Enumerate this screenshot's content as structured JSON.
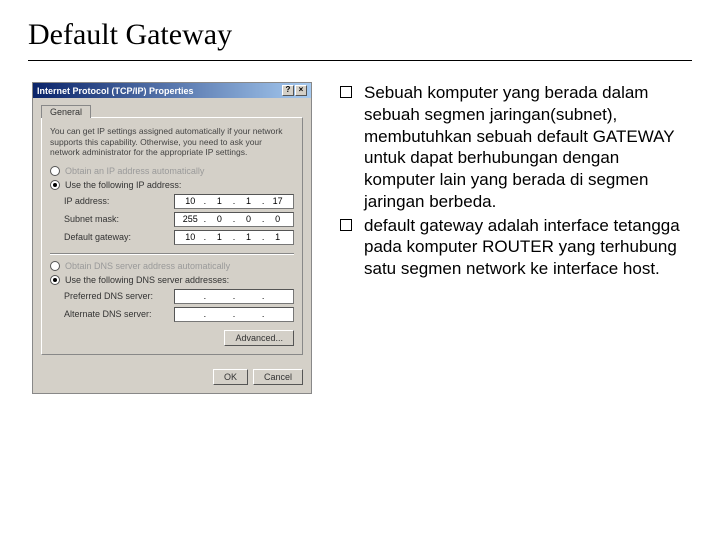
{
  "title": "Default Gateway",
  "dialog": {
    "titlebar": "Internet Protocol (TCP/IP) Properties",
    "tab": "General",
    "help": "You can get IP settings assigned automatically if your network supports this capability. Otherwise, you need to ask your network administrator for the appropriate IP settings.",
    "radio_auto_ip": "Obtain an IP address automatically",
    "radio_manual_ip": "Use the following IP address:",
    "lbl_ip": "IP address:",
    "lbl_mask": "Subnet mask:",
    "lbl_gw": "Default gateway:",
    "ip": {
      "a": "10",
      "b": "1",
      "c": "1",
      "d": "17"
    },
    "mask": {
      "a": "255",
      "b": "0",
      "c": "0",
      "d": "0"
    },
    "gw": {
      "a": "10",
      "b": "1",
      "c": "1",
      "d": "1"
    },
    "radio_auto_dns": "Obtain DNS server address automatically",
    "radio_manual_dns": "Use the following DNS server addresses:",
    "lbl_pref_dns": "Preferred DNS server:",
    "lbl_alt_dns": "Alternate DNS server:",
    "btn_advanced": "Advanced...",
    "btn_ok": "OK",
    "btn_cancel": "Cancel"
  },
  "bullets": {
    "b1": "Sebuah komputer yang berada dalam sebuah segmen jaringan(subnet), membutuhkan sebuah default GATEWAY untuk dapat berhubungan dengan komputer lain yang berada di segmen jaringan berbeda.",
    "b2": "default gateway adalah interface tetangga pada komputer ROUTER yang terhubung satu segmen network ke interface host."
  }
}
